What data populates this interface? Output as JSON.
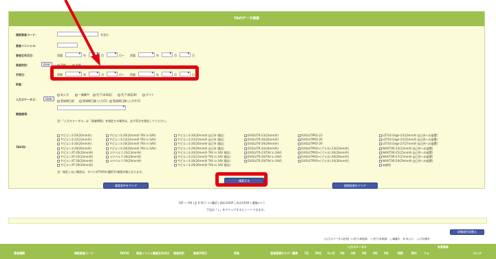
{
  "panel": {
    "title": "TAVIデータ検索",
    "labels": {
      "facility_code": "施設患者コード：",
      "patient_initial": "患者イニシャル：",
      "birth_date": "患者生年月日：",
      "patient_gender": "患者性別：",
      "surgery_date": "手術日：",
      "procedure": "術者：",
      "input_status": "入力ステータス：",
      "survey_items": "調査細項：",
      "tavi_device": "TAVI弁："
    },
    "facility_code_suffix": "を含む",
    "clear_label": "clear",
    "date_parts": {
      "from": "西暦",
      "year": "年",
      "month": "月",
      "day": "日～",
      "to": "西暦",
      "day_end": "日"
    },
    "gender_options": [
      "男性",
      "女性"
    ],
    "status_options": [
      "未入力",
      "一編集中",
      "完了(未承認)",
      "完了(承認済)",
      "すべて"
    ],
    "status_options2": [
      "登録期日前",
      "登録期日後 (入力可)",
      "登録期日後 (入力不可)"
    ],
    "survey_note": "注）「入力ステータス」は「調査期限」を指定する場合は、必ず両方を指定してください。",
    "tavi_note": "注）指定しない場合は、すべてのTAVI弁(選択可)検索対象となります。",
    "tavi_col1": [
      "サピエン3-20(20mm弁)",
      "サピエン3-23(23mm弁)",
      "サピエン3-26(26mm弁)",
      "サピエン3-29(29mm弁)",
      "サピエンXT-20(20mm弁)",
      "サピエンXT-23(23mm弁)",
      "サピエンXT-26(26mm弁)",
      "サピエンXT-29(29mm弁)"
    ],
    "tavi_col2": [
      "サピエン3-20(20mm弁 TAV in SAV)",
      "サピエン3-23(23mm弁 TAV in SAV)",
      "サピエン3-26(26mm弁 TAV in SAV)",
      "サピエン3-29(29mm弁 TAV in SAV)",
      "コアバルブ-23(23mm弁)",
      "コアバルブ-26(26mm弁)",
      "コアバルブ-29(29mm弁)"
    ],
    "tavi_col3": [
      "サピエン3-20(20mm弁 自己弁 適応)",
      "サピエン3-23(23mm弁 自己弁 適応)",
      "サピエン3-26(26mm弁 自己弁 適応)",
      "サピエン3-29(29mm弁 自己弁 適応)",
      "サピエン3-20(20mm弁 TAV in SAV 適応)",
      "サピエン3-23(23mm弁 TAV in SAV 適応)",
      "サピエン3-26(26mm弁 TAV in SAV 適応)",
      "サピエン3-29(29mm弁 TAV in SAV 適応)"
    ],
    "tavi_col4": [
      "EVOLUTR-23(23mm弁)",
      "EVOLUTR-26(26mm弁)",
      "EVOLUTR-29(29mm弁)",
      "EVOLUTR-34(34mm弁)",
      "EVOLUTR-23(TAV in SAV)",
      "EVOLUTR-26(TAV in SAV)",
      "EVOLUTR-29(TAV in SAV)"
    ],
    "tavi_col5": [
      "EVOLUTPRO-23",
      "EVOLUTPRO-26",
      "EVOLUTPRO-29",
      "EVOLUTPRO+(プラス)-23(23mm弁)",
      "EVOLUTPRO+(プラス)-26(26mm弁)",
      "EVOLUTPRO+(プラス)-29(29mm弁)",
      "EVOLUTPRO+(プラス)-34(34mm弁)"
    ],
    "tavi_col6": [
      "LOTUS Edge-23(23mm弁 自己弁への留置)",
      "LOTUS Edge-25(25mm弁 自己弁への留置)",
      "LOTUS Edge-27(27mm弁 自己弁への留置)",
      "NAVITOR-23(23mm弁 自己弁への留置)",
      "NAVITOR-25(25mm弁 自己弁への留置)",
      "NAVITOR-27(27mm弁 自己弁への留置)",
      "NAVITOR-29(29mm弁 自己弁への留置)",
      "未使用"
    ],
    "buttons": {
      "clear_conditions": "検索条件をクリア",
      "search": "検索する",
      "clear_results": "検索結果をクリア"
    }
  },
  "pagination": {
    "summary": "0件 ～ 0件 (全 0 件) [ <<最初 | 前の100件 | 次の100件 | 最後>> ]",
    "hint": "下記の「↓」をクリックするとソートできます。"
  },
  "results": {
    "detail_button": "詳細項目切替え",
    "legend": "【入力ステータス記号】◎:完了(承認済)　○:完了(未承認)　△:編集中　未:未入力　-:入力対象外",
    "columns": [
      "患者種類",
      "施設患者コード",
      "TAVI弁",
      "患者イニシャル",
      "患者生年月日",
      "患者性別",
      "患者手術日",
      "術者",
      "患者登録のステータス",
      "基本",
      "7日",
      "30日",
      "6ヶ月",
      "1年",
      "2年",
      "3年",
      "4年",
      "5年",
      "術前",
      "術中",
      "フォ",
      "ロック"
    ],
    "group_header": "入力ステータス",
    "group_header2": "有害事象"
  },
  "colors": {
    "header_green": "#9ec04e",
    "panel_bg": "#fbfbd7",
    "button_blue": "#4459a6",
    "highlight_red": "#e10010"
  }
}
